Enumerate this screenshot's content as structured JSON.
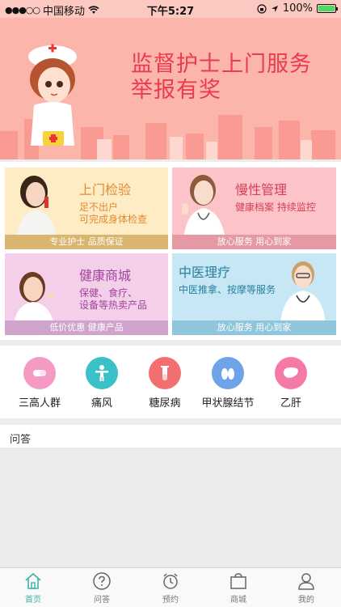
{
  "status": {
    "carrier": "中国移动",
    "time": "下午5:27",
    "battery_pct": "100%"
  },
  "banner": {
    "title_line1": "监督护士上门服务",
    "title_line2": "举报有奖"
  },
  "cards": [
    {
      "title": "上门检验",
      "desc_line1": "足不出户",
      "desc_line2": "可完成身体检查",
      "footer": "专业护士  品质保证"
    },
    {
      "title": "慢性管理",
      "desc_line1": "健康档案  持续监控",
      "desc_line2": "",
      "footer": "放心服务  用心到家"
    },
    {
      "title": "健康商城",
      "desc_line1": "保健、食疗、",
      "desc_line2": "设备等热卖产品",
      "footer": "低价优惠  健康产品"
    },
    {
      "title": "中医理疗",
      "desc_line1": "中医推拿、按摩等服务",
      "desc_line2": "",
      "footer": "放心服务  用心到家"
    }
  ],
  "categories": [
    {
      "label": "三高人群",
      "color": "#f49ac5",
      "icon": "pill-icon"
    },
    {
      "label": "痛风",
      "color": "#3cc0c8",
      "icon": "body-icon"
    },
    {
      "label": "糖尿病",
      "color": "#f36f6f",
      "icon": "test-tube-icon"
    },
    {
      "label": "甲状腺结节",
      "color": "#6fa3e8",
      "icon": "thyroid-icon"
    },
    {
      "label": "乙肝",
      "color": "#f479a7",
      "icon": "liver-icon"
    }
  ],
  "qa": {
    "title": "问答"
  },
  "tabs": [
    {
      "label": "首页",
      "icon": "home-icon",
      "active": true
    },
    {
      "label": "问答",
      "icon": "question-icon",
      "active": false
    },
    {
      "label": "预约",
      "icon": "alarm-clock-icon",
      "active": false
    },
    {
      "label": "商城",
      "icon": "shopping-bag-icon",
      "active": false
    },
    {
      "label": "我的",
      "icon": "user-icon",
      "active": false
    }
  ],
  "colors": {
    "accent": "#3fb3a7",
    "banner_bg": "#fcb5aa",
    "banner_title": "#ea3b4f"
  }
}
